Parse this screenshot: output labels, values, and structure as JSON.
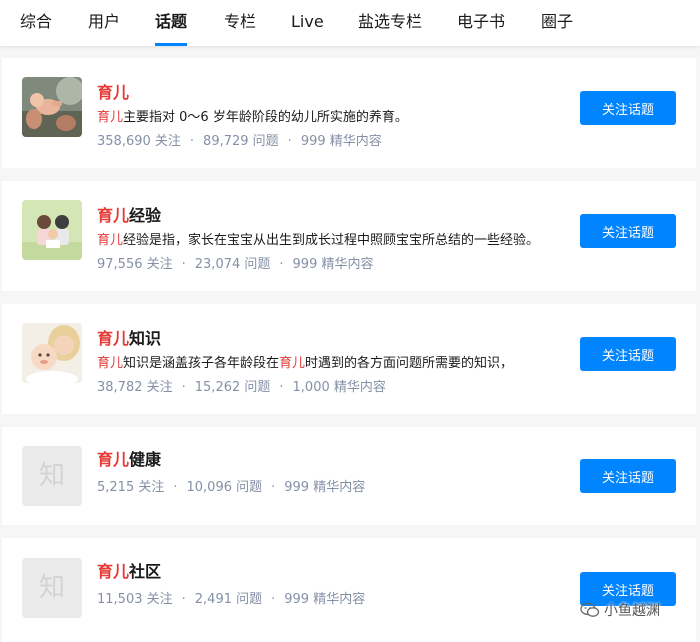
{
  "tabs": [
    {
      "label": "综合"
    },
    {
      "label": "用户"
    },
    {
      "label": "话题",
      "active": true
    },
    {
      "label": "专栏"
    },
    {
      "label": "Live"
    },
    {
      "label": "盐选专栏"
    },
    {
      "label": "电子书"
    },
    {
      "label": "圈子"
    }
  ],
  "search_keyword_color": "#e53935",
  "accent_color": "#0084ff",
  "topics": [
    {
      "title_hl": "育儿",
      "title_rest": "",
      "desc_hl": "育儿",
      "desc_rest": "主要指对 0～6 岁年龄阶段的幼儿所实施的养育。",
      "followers": "358,690 关注",
      "questions": "89,729 问题",
      "featured": "999 精华内容",
      "avatar": "photo-baby-lifted",
      "button": "关注话题"
    },
    {
      "title_hl": "育儿",
      "title_rest": "经验",
      "desc_hl": "育儿",
      "desc_rest": "经验是指，家长在宝宝从出生到成长过程中照顾宝宝所总结的一些经验。",
      "followers": "97,556 关注",
      "questions": "23,074 问题",
      "featured": "999 精华内容",
      "avatar": "illustration-family-reading",
      "button": "关注话题"
    },
    {
      "title_hl": "育儿",
      "title_rest": "知识",
      "desc_hl": "育儿",
      "desc_rest": "知识是涵盖孩子各年龄段在",
      "desc_hl2": "育儿",
      "desc_rest2": "时遇到的各方面问题所需要的知识，",
      "followers": "38,782 关注",
      "questions": "15,262 问题",
      "featured": "1,000 精华内容",
      "avatar": "photo-mother-baby",
      "button": "关注话题"
    },
    {
      "title_hl": "育儿",
      "title_rest": "健康",
      "followers": "5,215 关注",
      "questions": "10,096 问题",
      "featured": "999 精华内容",
      "avatar_text": "知",
      "button": "关注话题"
    },
    {
      "title_hl": "育儿",
      "title_rest": "社区",
      "followers": "11,503 关注",
      "questions": "2,491 问题",
      "featured": "999 精华内容",
      "avatar_text": "知",
      "button": "关注话题"
    }
  ],
  "meta_separator": "·",
  "watermark": {
    "text": "小鱼越渊",
    "icon": "wechat-icon"
  }
}
